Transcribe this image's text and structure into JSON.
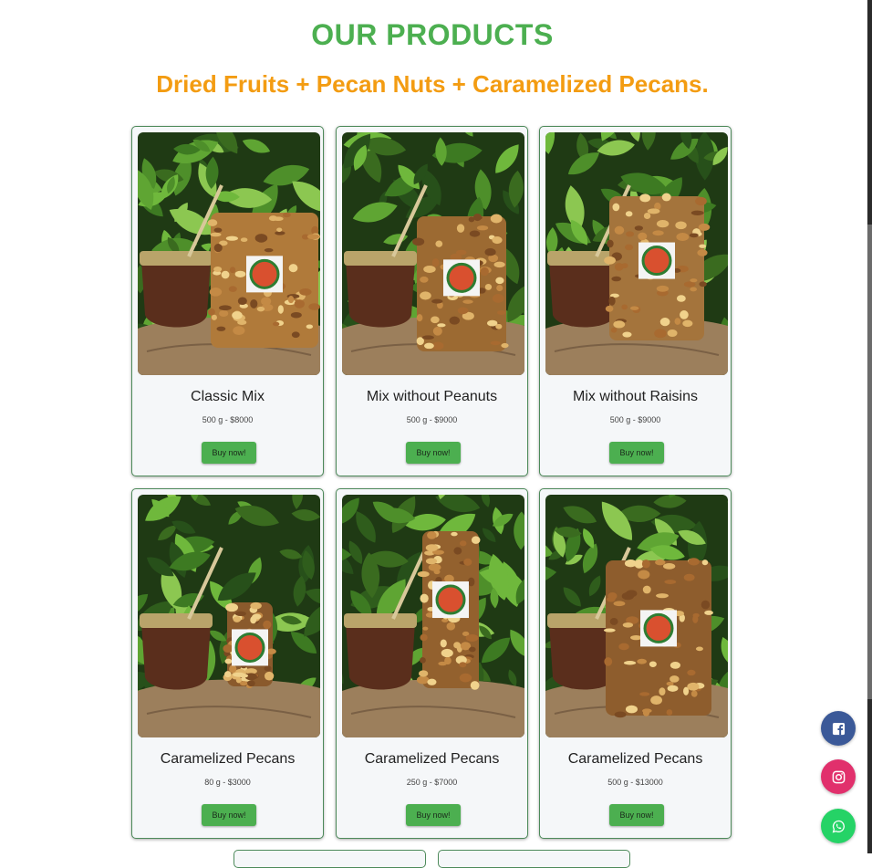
{
  "header": {
    "title": "OUR PRODUCTS",
    "subtitle": "Dried Fruits + Pecan Nuts + Caramelized Pecans."
  },
  "colors": {
    "title_green": "#4caf50",
    "subtitle_orange": "#f39c12",
    "button_green": "#4caf50",
    "card_bg": "#f5f7f9",
    "card_border": "#4d8a5a",
    "facebook": "#3b5998",
    "instagram": "#e1306c",
    "whatsapp": "#25d366"
  },
  "products": [
    {
      "name": "Classic Mix",
      "price": "500 g - $8000",
      "button": "Buy now!"
    },
    {
      "name": "Mix without Peanuts",
      "price": "500 g - $9000",
      "button": "Buy now!"
    },
    {
      "name": "Mix without Raisins",
      "price": "500 g - $9000",
      "button": "Buy now!"
    },
    {
      "name": "Caramelized Pecans",
      "price": "80 g - $3000",
      "button": "Buy now!"
    },
    {
      "name": "Caramelized Pecans",
      "price": "250 g - $7000",
      "button": "Buy now!"
    },
    {
      "name": "Caramelized Pecans",
      "price": "500 g - $13000",
      "button": "Buy now!"
    }
  ],
  "social": [
    {
      "icon": "facebook-icon"
    },
    {
      "icon": "instagram-icon"
    },
    {
      "icon": "whatsapp-icon"
    }
  ]
}
